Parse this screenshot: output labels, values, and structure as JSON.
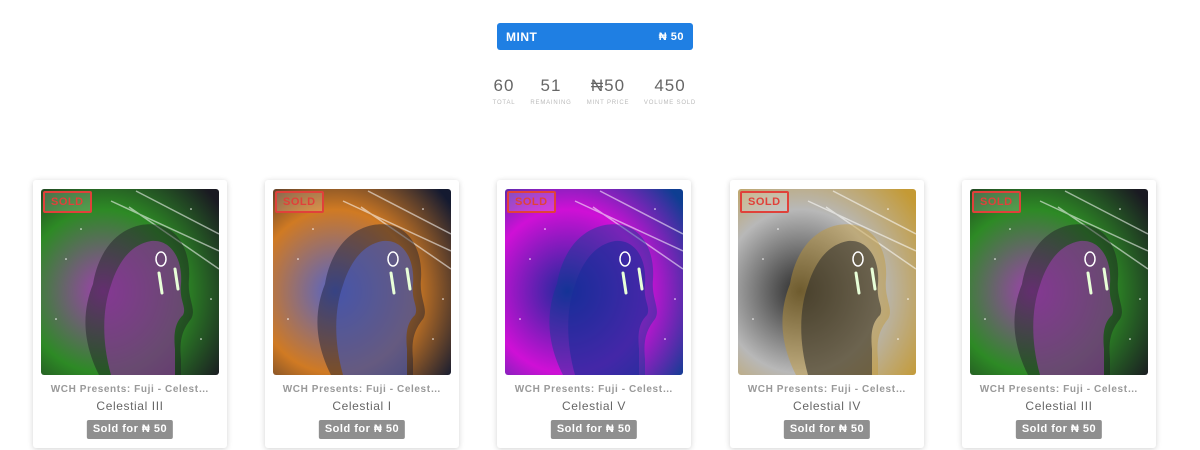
{
  "mint": {
    "label": "MINT",
    "price": "₦ 50",
    "color": "#1f7fe3"
  },
  "stats": [
    {
      "value": "60",
      "label": "TOTAL"
    },
    {
      "value": "51",
      "label": "REMAINING"
    },
    {
      "value": "₦50",
      "label": "MINT PRICE"
    },
    {
      "value": "450",
      "label": "VOLUME SOLD"
    }
  ],
  "cards": [
    {
      "badge": "SOLD",
      "collection": "WCH Presents: Fuji - Celest…",
      "name": "Celestial III",
      "sold_for": "Sold for ₦ 50",
      "art_colors": [
        "#2d8a25",
        "#a03fb0",
        "#1a1a22"
      ]
    },
    {
      "badge": "SOLD",
      "collection": "WCH Presents: Fuji - Celest…",
      "name": "Celestial I",
      "sold_for": "Sold for ₦ 50",
      "art_colors": [
        "#d07a23",
        "#5464c8",
        "#141a30"
      ]
    },
    {
      "badge": "SOLD",
      "collection": "WCH Presents: Fuji - Celest…",
      "name": "Celestial V",
      "sold_for": "Sold for ₦ 50",
      "art_colors": [
        "#cf10d6",
        "#1a2a9a",
        "#0e3e92"
      ]
    },
    {
      "badge": "SOLD",
      "collection": "WCH Presents: Fuji - Celest…",
      "name": "Celestial IV",
      "sold_for": "Sold for ₦ 50",
      "art_colors": [
        "#b8b8b8",
        "#2a2a2a",
        "#c49a35"
      ]
    },
    {
      "badge": "SOLD",
      "collection": "WCH Presents: Fuji - Celest…",
      "name": "Celestial III",
      "sold_for": "Sold for ₦ 50",
      "art_colors": [
        "#2d8a25",
        "#a03fb0",
        "#1a1a22"
      ]
    }
  ]
}
